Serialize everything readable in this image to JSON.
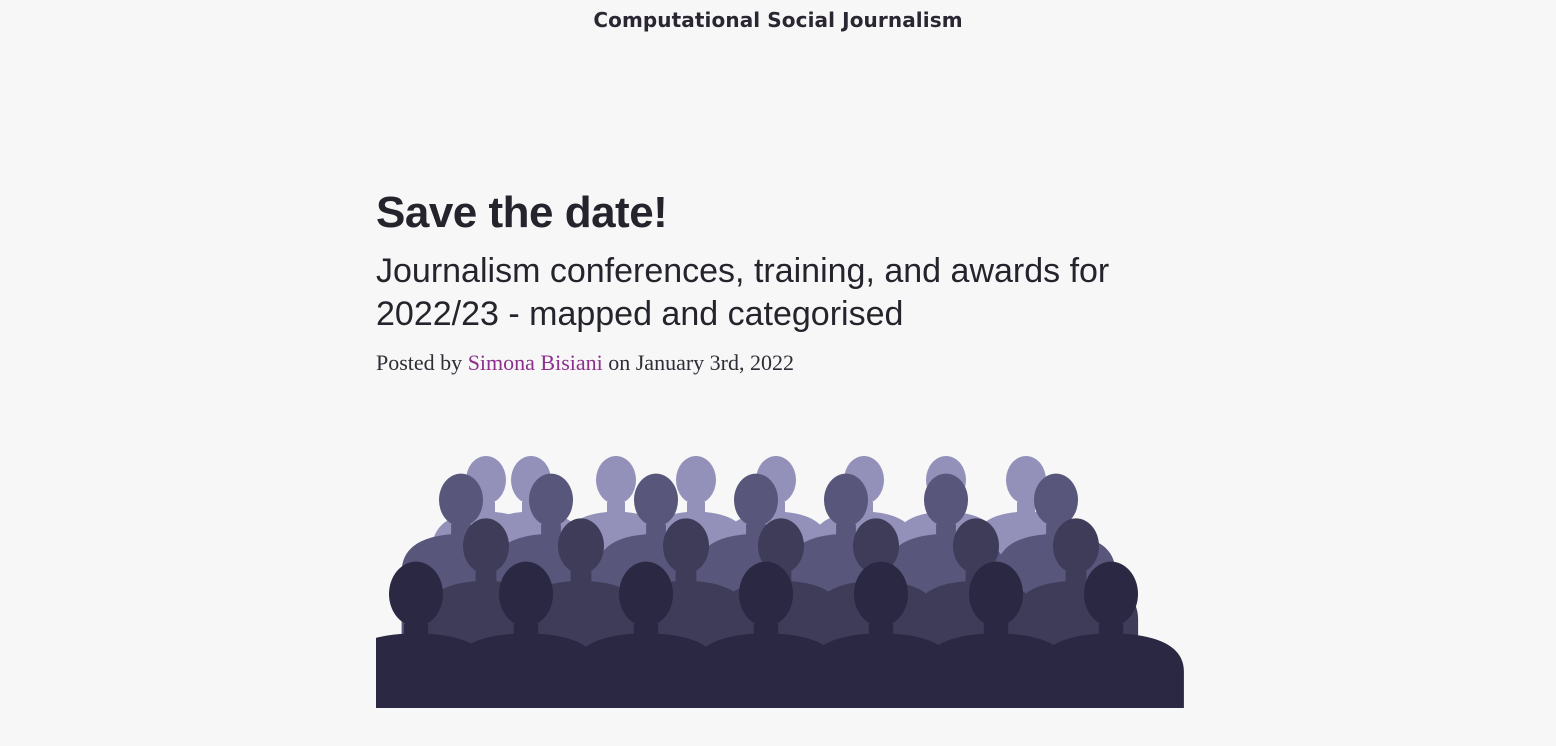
{
  "site": {
    "title": "Computational Social Journalism"
  },
  "post": {
    "title": "Save the date!",
    "subtitle": "Journalism conferences, training, and awards for 2022/23 - mapped and categorised",
    "meta": {
      "prefix": "Posted by",
      "author": "Simona Bisiani",
      "date_text": "on January 3rd, 2022"
    }
  },
  "image": {
    "subject": "crowd-silhouettes-illustration",
    "colors": {
      "back": "#9391ba",
      "mid": "#58567a",
      "mid_dark": "#3e3c58",
      "front": "#2a2843"
    }
  },
  "colors": {
    "background": "#f7f7f7",
    "link": "#8c2f8e",
    "text": "#25232c"
  }
}
